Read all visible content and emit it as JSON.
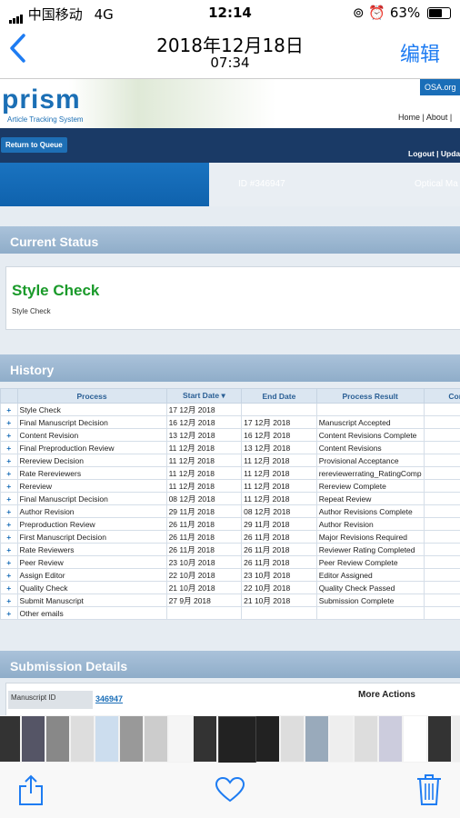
{
  "status_bar": {
    "carrier": "中国移动",
    "network": "4G",
    "time": "12:14",
    "battery": "63%",
    "battery_level": 0.63
  },
  "nav": {
    "date": "2018年12月18日",
    "subtime": "07:34",
    "edit": "编辑",
    "back_icon": "chevron-left-icon"
  },
  "prism": {
    "logo": "prism",
    "tagline": "Article Tracking System",
    "osa_link": "OSA.org",
    "topnav": "Home | About |",
    "return_button": "Return to Queue",
    "logout": "Logout | Upda",
    "id_label": "ID #346947",
    "journal": "Optical Ma"
  },
  "current_status": {
    "heading": "Current Status",
    "status": "Style Check",
    "status_small": "Style Check"
  },
  "history": {
    "heading": "History",
    "columns": [
      "",
      "Process",
      "Start Date ▾",
      "End Date",
      "Process Result",
      "Com"
    ],
    "rows": [
      [
        "+",
        "Style Check",
        "17 12月 2018",
        "",
        "",
        ""
      ],
      [
        "+",
        "Final Manuscript Decision",
        "16 12月 2018",
        "17 12月 2018",
        "Manuscript Accepted",
        ""
      ],
      [
        "+",
        "Content Revision",
        "13 12月 2018",
        "16 12月 2018",
        "Content Revisions Complete",
        ""
      ],
      [
        "+",
        "Final Preproduction Review",
        "11 12月 2018",
        "13 12月 2018",
        "Content Revisions",
        ""
      ],
      [
        "+",
        "Rereview Decision",
        "11 12月 2018",
        "11 12月 2018",
        "Provisional Acceptance",
        ""
      ],
      [
        "+",
        "Rate Rereviewers",
        "11 12月 2018",
        "11 12月 2018",
        "rereviewerrating_RatingComp",
        ""
      ],
      [
        "+",
        "Rereview",
        "11 12月 2018",
        "11 12月 2018",
        "Rereview Complete",
        ""
      ],
      [
        "+",
        "Final Manuscript Decision",
        "08 12月 2018",
        "11 12月 2018",
        "Repeat Review",
        ""
      ],
      [
        "+",
        "Author Revision",
        "29 11月 2018",
        "08 12月 2018",
        "Author Revisions Complete",
        ""
      ],
      [
        "+",
        "Preproduction Review",
        "26 11月 2018",
        "29 11月 2018",
        "Author Revision",
        ""
      ],
      [
        "+",
        "First Manuscript Decision",
        "26 11月 2018",
        "26 11月 2018",
        "Major Revisions Required",
        ""
      ],
      [
        "+",
        "Rate Reviewers",
        "26 11月 2018",
        "26 11月 2018",
        "Reviewer Rating Completed",
        ""
      ],
      [
        "+",
        "Peer Review",
        "23 10月 2018",
        "26 11月 2018",
        "Peer Review Complete",
        ""
      ],
      [
        "+",
        "Assign Editor",
        "22 10月 2018",
        "23 10月 2018",
        "Editor Assigned",
        ""
      ],
      [
        "+",
        "Quality Check",
        "21 10月 2018",
        "22 10月 2018",
        "Quality Check Passed",
        ""
      ],
      [
        "+",
        "Submit Manuscript",
        "27 9月 2018",
        "21 10月 2018",
        "Submission Complete",
        ""
      ],
      [
        "+",
        "Other emails",
        "",
        "",
        "",
        ""
      ]
    ]
  },
  "submission": {
    "heading": "Submission Details",
    "manuscript_label": "Manuscript ID",
    "manuscript_id": "346947",
    "more_actions": "More Actions"
  },
  "toolbar": {
    "share_icon": "share-icon",
    "favorite_icon": "heart-icon",
    "delete_icon": "trash-icon"
  }
}
